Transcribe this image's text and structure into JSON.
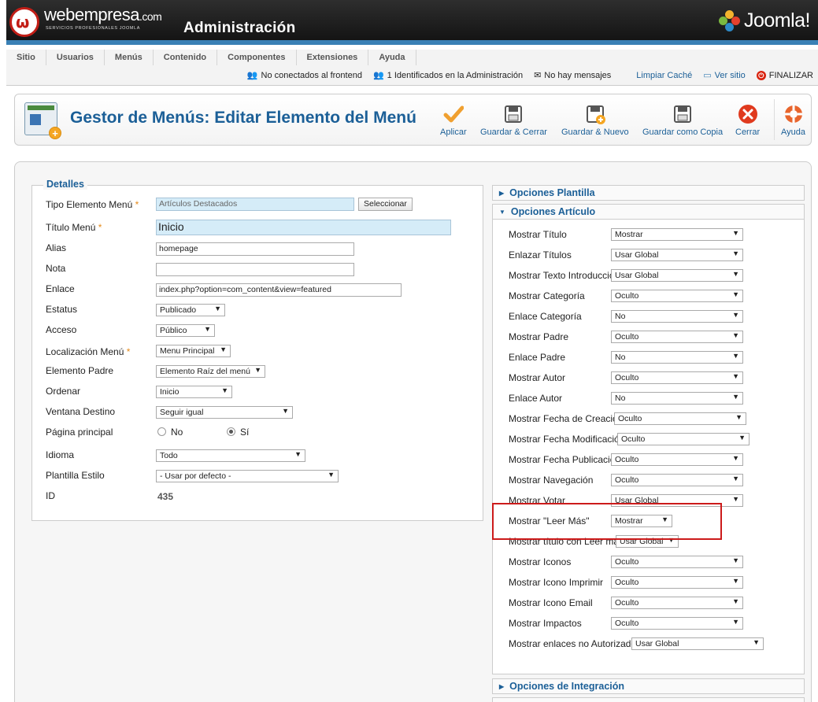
{
  "header": {
    "brand": "webempresa",
    "brand_suffix": ".com",
    "brand_tagline": "SERVICIOS PROFESIONALES JOOMLA",
    "title": "Administración",
    "joomla": "Joomla!"
  },
  "menu": [
    "Sitio",
    "Usuarios",
    "Menús",
    "Contenido",
    "Componentes",
    "Extensiones",
    "Ayuda"
  ],
  "status": {
    "frontend": "No conectados al frontend",
    "admin": "1 Identificados en la Administración",
    "messages": "No hay mensajes",
    "clear_cache": "Limpiar Caché",
    "view_site": "Ver sitio",
    "logout": "FINALIZAR"
  },
  "toolbar": {
    "page_title": "Gestor de Menús: Editar Elemento del Menú",
    "apply": "Aplicar",
    "save_close": "Guardar & Cerrar",
    "save_new": "Guardar & Nuevo",
    "save_copy": "Guardar como Copia",
    "close": "Cerrar",
    "help": "Ayuda"
  },
  "details": {
    "legend": "Detalles",
    "type_label": "Tipo Elemento Menú",
    "type_value": "Artículos Destacados",
    "select_button": "Seleccionar",
    "title_label": "Título Menú",
    "title_value": "Inicio",
    "alias_label": "Alias",
    "alias_value": "homepage",
    "note_label": "Nota",
    "note_value": "",
    "link_label": "Enlace",
    "link_value": "index.php?option=com_content&view=featured",
    "status_label": "Estatus",
    "status_value": "Publicado",
    "access_label": "Acceso",
    "access_value": "Público",
    "location_label": "Localización Menú",
    "location_value": "Menu Principal",
    "parent_label": "Elemento Padre",
    "parent_value": "Elemento Raíz del menú",
    "order_label": "Ordenar",
    "order_value": "Inicio",
    "target_label": "Ventana Destino",
    "target_value": "Seguir igual",
    "home_label": "Página principal",
    "home_no": "No",
    "home_yes": "Sí",
    "language_label": "Idioma",
    "language_value": "Todo",
    "template_label": "Plantilla Estilo",
    "template_value": "- Usar por defecto -",
    "id_label": "ID",
    "id_value": "435"
  },
  "accordion": {
    "template_options": "Opciones Plantilla",
    "article_options": "Opciones Artículo",
    "integration_options": "Opciones de Integración"
  },
  "article_options": [
    {
      "label": "Mostrar Título",
      "value": "Mostrar"
    },
    {
      "label": "Enlazar Títulos",
      "value": "Usar Global"
    },
    {
      "label": "Mostrar Texto Introducción",
      "value": "Usar Global"
    },
    {
      "label": "Mostrar Categoría",
      "value": "Oculto"
    },
    {
      "label": "Enlace Categoría",
      "value": "No"
    },
    {
      "label": "Mostrar Padre",
      "value": "Oculto"
    },
    {
      "label": "Enlace Padre",
      "value": "No"
    },
    {
      "label": "Mostrar Autor",
      "value": "Oculto"
    },
    {
      "label": "Enlace Autor",
      "value": "No"
    },
    {
      "label": "Mostrar Fecha de Creación",
      "value": "Oculto"
    },
    {
      "label": "Mostrar Fecha Modificación",
      "value": "Oculto"
    },
    {
      "label": "Mostrar Fecha Publicación",
      "value": "Oculto"
    },
    {
      "label": "Mostrar Navegación",
      "value": "Oculto"
    },
    {
      "label": "Mostrar Votar",
      "value": "Usar Global"
    },
    {
      "label": "Mostrar \"Leer Más\"",
      "value": "Mostrar"
    },
    {
      "label": "Mostrar título con Leer más",
      "value": "Usar Global"
    },
    {
      "label": "Mostrar Iconos",
      "value": "Oculto"
    },
    {
      "label": "Mostrar Icono Imprimir",
      "value": "Oculto"
    },
    {
      "label": "Mostrar Icono Email",
      "value": "Oculto"
    },
    {
      "label": "Mostrar Impactos",
      "value": "Oculto"
    },
    {
      "label": "Mostrar enlaces no Autorizados",
      "value": "Usar Global"
    }
  ],
  "colors": {
    "accent": "#1b5f97",
    "header_bg": "#1e1e1e",
    "header_stripe": "#3a80b5",
    "highlight": "#cc1b1b"
  }
}
